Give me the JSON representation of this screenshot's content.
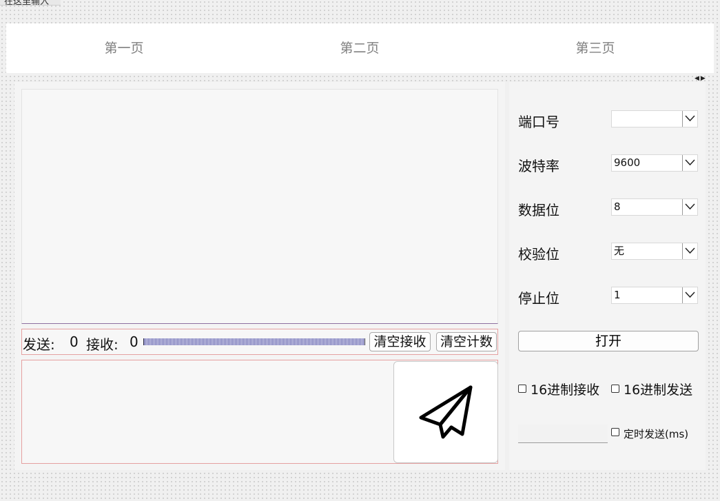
{
  "top_label": "在这里输入",
  "tabs": [
    "第一页",
    "第二页",
    "第三页"
  ],
  "stats": {
    "send_label": "发送:",
    "send_count": "0",
    "recv_label": "接收:",
    "recv_count": "0",
    "clear_recv": "清空接收",
    "clear_count": "清空计数"
  },
  "settings": {
    "port": {
      "label": "端口号",
      "value": ""
    },
    "baud": {
      "label": "波特率",
      "value": "9600"
    },
    "databits": {
      "label": "数据位",
      "value": "8"
    },
    "parity": {
      "label": "校验位",
      "value": "无"
    },
    "stopbits": {
      "label": "停止位",
      "value": "1"
    }
  },
  "open_button": "打开",
  "hex_recv": "16进制接收",
  "hex_send": "16进制发送",
  "timer_send": "定时发送(ms)",
  "icons": {
    "send": "paper-plane-icon",
    "dropdown": "chevron-down-icon",
    "splitter": "splitter-arrows-icon"
  }
}
